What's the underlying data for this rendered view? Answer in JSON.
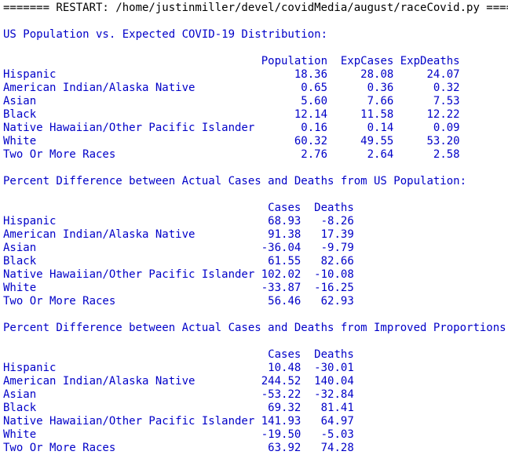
{
  "restart_line": "======= RESTART: /home/justinmiller/devel/covidMedia/august/raceCovid.py =======",
  "colors": {
    "stdout": "#0000c8",
    "restart": "#000000",
    "background": "#ffffff"
  },
  "section1": {
    "heading": "US Population vs. Expected COVID-19 Distribution:",
    "headers": [
      "Population",
      "ExpCases",
      "ExpDeaths"
    ],
    "rows": [
      [
        "Hispanic",
        "18.36",
        "28.08",
        "24.07"
      ],
      [
        "American Indian/Alaska Native",
        "0.65",
        "0.36",
        "0.32"
      ],
      [
        "Asian",
        "5.60",
        "7.66",
        "7.53"
      ],
      [
        "Black",
        "12.14",
        "11.58",
        "12.22"
      ],
      [
        "Native Hawaiian/Other Pacific Islander",
        "0.16",
        "0.14",
        "0.09"
      ],
      [
        "White",
        "60.32",
        "49.55",
        "53.20"
      ],
      [
        "Two Or More Races",
        "2.76",
        "2.64",
        "2.58"
      ]
    ]
  },
  "section2": {
    "heading": "Percent Difference between Actual Cases and Deaths from US Population:",
    "headers": [
      "Cases",
      "Deaths"
    ],
    "rows": [
      [
        "Hispanic",
        "68.93",
        "-8.26"
      ],
      [
        "American Indian/Alaska Native",
        "91.38",
        "17.39"
      ],
      [
        "Asian",
        "-36.04",
        "-9.79"
      ],
      [
        "Black",
        "61.55",
        "82.66"
      ],
      [
        "Native Hawaiian/Other Pacific Islander",
        "102.02",
        "-10.08"
      ],
      [
        "White",
        "-33.87",
        "-16.25"
      ],
      [
        "Two Or More Races",
        "56.46",
        "62.93"
      ]
    ]
  },
  "section3": {
    "heading": "Percent Difference between Actual Cases and Deaths from Improved Proportions:",
    "headers": [
      "Cases",
      "Deaths"
    ],
    "rows": [
      [
        "Hispanic",
        "10.48",
        "-30.01"
      ],
      [
        "American Indian/Alaska Native",
        "244.52",
        "140.04"
      ],
      [
        "Asian",
        "-53.22",
        "-32.84"
      ],
      [
        "Black",
        "69.32",
        "81.41"
      ],
      [
        "Native Hawaiian/Other Pacific Islander",
        "141.93",
        "64.97"
      ],
      [
        "White",
        "-19.50",
        "-5.03"
      ],
      [
        "Two Or More Races",
        "63.92",
        "74.28"
      ]
    ]
  }
}
